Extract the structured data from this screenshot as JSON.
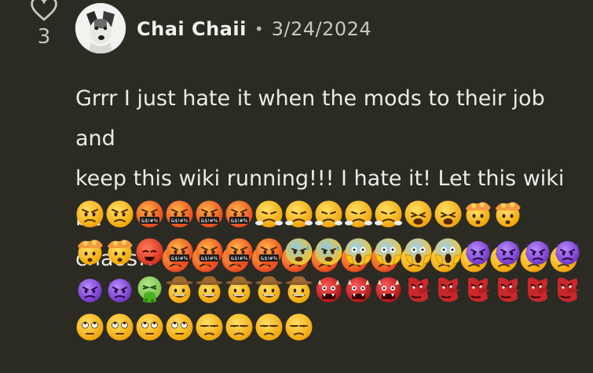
{
  "post": {
    "like_count": "3",
    "author": "Chai Chaii",
    "separator": "•",
    "date": "3/24/2024",
    "text_line1": "Grrr I just hate it when the mods to their job and",
    "text_line2": "keep this wiki running!!! I hate it! Let this wiki be",
    "text_line3": "chaos!!"
  },
  "emojis": {
    "line3": [
      "angry-red",
      "angry-red",
      "angry-red",
      "angry-red",
      "angry-red",
      "angry-red",
      "angry-red",
      "angry-red",
      "angry-yellow",
      "angry-yellow",
      "angry-yellow",
      "angry-yellow",
      "angry-yellow",
      "angry-yellow"
    ],
    "row1": [
      "angry-yellow",
      "angry-yellow",
      "cursing",
      "cursing",
      "cursing",
      "cursing",
      "triumph",
      "triumph",
      "triumph",
      "triumph",
      "triumph",
      "tired",
      "weary",
      "exploding",
      "exploding"
    ],
    "row2": [
      "exploding",
      "exploding",
      "hot",
      "cursing",
      "cursing",
      "cursing",
      "cursing",
      "sweat",
      "sweat",
      "scream",
      "scream",
      "scream",
      "scream",
      "imp",
      "imp",
      "imp",
      "imp"
    ],
    "row3": [
      "imp",
      "imp",
      "vomit",
      "cowboy",
      "cowboy",
      "cowboy",
      "cowboy",
      "cowboy",
      "ogre",
      "ogre",
      "ogre",
      "goblin",
      "goblin",
      "goblin",
      "goblin",
      "goblin",
      "goblin"
    ],
    "row4": [
      "eyeroll",
      "eyeroll",
      "eyeroll",
      "eyeroll",
      "unamused",
      "unamused",
      "unamused",
      "unamused"
    ]
  }
}
